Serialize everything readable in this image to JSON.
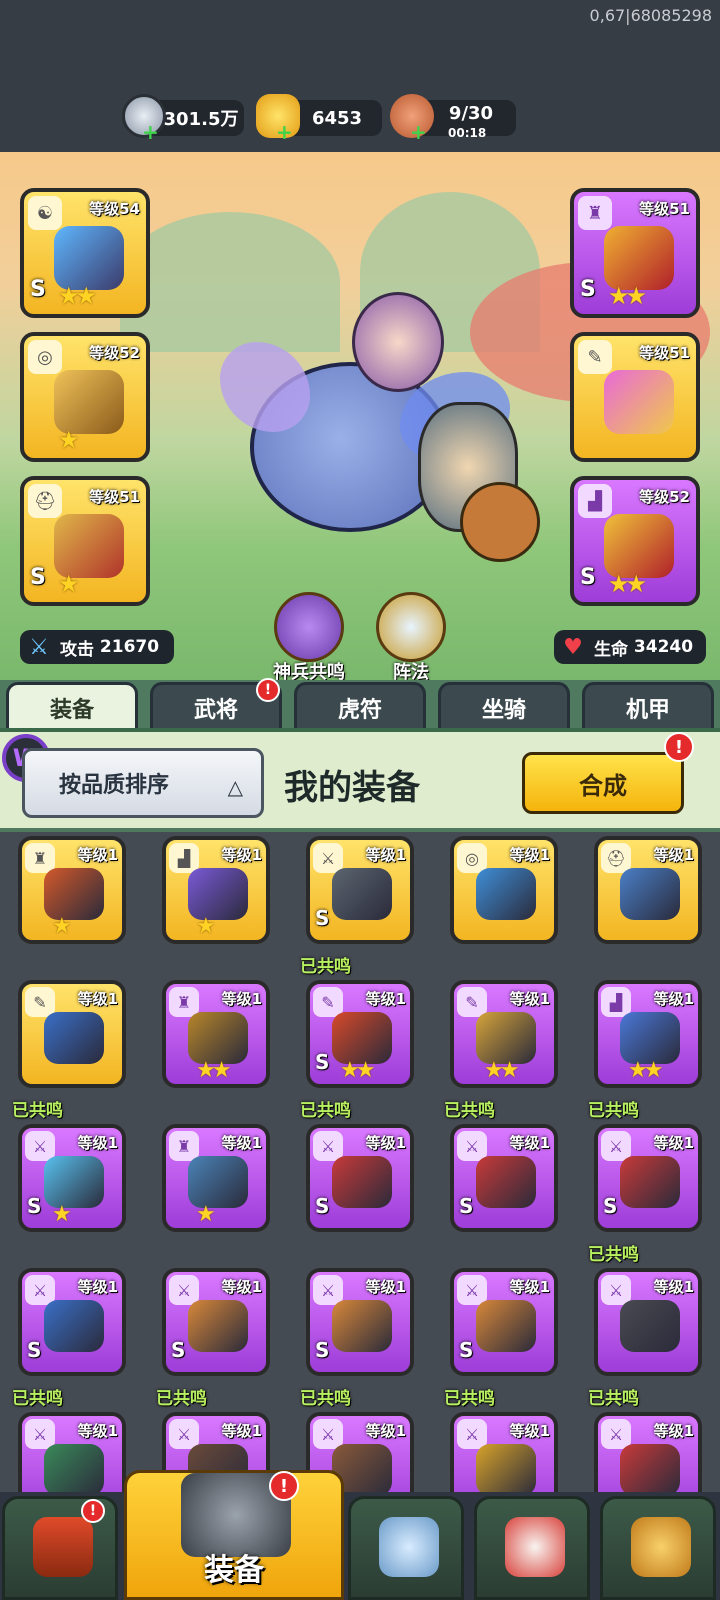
{
  "debug_text": "0,67|68085298",
  "resources": {
    "silver": {
      "value": "301.5万",
      "icon": "silver-coin-icon"
    },
    "gold": {
      "value": "6453",
      "icon": "gold-ingot-icon"
    },
    "stamina": {
      "value": "9/30",
      "timer": "00:18",
      "icon": "meat-leg-icon"
    }
  },
  "equipped_left": [
    {
      "slot": "weapon",
      "tag_icon": "yin-yang-icon",
      "level": "等级54",
      "rarity": "gold",
      "grade": "S",
      "stars": 2
    },
    {
      "slot": "necklace",
      "tag_icon": "medal-icon",
      "level": "等级52",
      "rarity": "gold",
      "grade": "",
      "stars": 1
    },
    {
      "slot": "helmet",
      "tag_icon": "helmet-icon",
      "level": "等级51",
      "rarity": "gold",
      "grade": "S",
      "stars": 1
    }
  ],
  "equipped_right": [
    {
      "slot": "armor",
      "tag_icon": "armor-icon",
      "level": "等级51",
      "rarity": "purple",
      "grade": "S",
      "stars": 2
    },
    {
      "slot": "bracer",
      "tag_icon": "bracer-icon",
      "level": "等级51",
      "rarity": "gold",
      "grade": "",
      "stars": 0
    },
    {
      "slot": "boots",
      "tag_icon": "boot-icon",
      "level": "等级52",
      "rarity": "purple",
      "grade": "S",
      "stars": 2
    }
  ],
  "stats": {
    "attack": {
      "label": "攻击",
      "value": "21670"
    },
    "hp": {
      "label": "生命",
      "value": "34240"
    }
  },
  "center_buttons": [
    "神兵共鸣",
    "阵法"
  ],
  "tabs": [
    "装备",
    "武将",
    "虎符",
    "坐骑",
    "机甲"
  ],
  "active_tab": 0,
  "header": {
    "sort_label": "按品质排序",
    "title": "我的装备",
    "merge_label": "合成"
  },
  "resonated_label": "已共鸣",
  "items": [
    {
      "rarity": "gold",
      "tag": "armor",
      "level": "等级1",
      "grade": "",
      "stars": 1,
      "resonated": false,
      "color": "#d4592b"
    },
    {
      "rarity": "gold",
      "tag": "boot",
      "level": "等级1",
      "grade": "",
      "stars": 1,
      "resonated": false,
      "color": "#7a5ad8"
    },
    {
      "rarity": "gold",
      "tag": "sword",
      "level": "等级1",
      "grade": "S",
      "stars": 0,
      "resonated": false,
      "color": "#5b6670"
    },
    {
      "rarity": "gold",
      "tag": "medal",
      "level": "等级1",
      "grade": "",
      "stars": 0,
      "resonated": false,
      "color": "#3f8fd8"
    },
    {
      "rarity": "gold",
      "tag": "helmet",
      "level": "等级1",
      "grade": "",
      "stars": 0,
      "resonated": false,
      "color": "#4a7fc8"
    },
    {
      "rarity": "gold",
      "tag": "bracer",
      "level": "等级1",
      "grade": "",
      "stars": 0,
      "resonated": false,
      "color": "#3a6fc8"
    },
    {
      "rarity": "purple",
      "tag": "armor",
      "level": "等级1",
      "grade": "",
      "stars": 2,
      "resonated": false,
      "color": "#b8862a"
    },
    {
      "rarity": "purple",
      "tag": "bracer",
      "level": "等级1",
      "grade": "S",
      "stars": 2,
      "resonated": true,
      "color": "#d84a2a"
    },
    {
      "rarity": "purple",
      "tag": "bracer",
      "level": "等级1",
      "grade": "",
      "stars": 2,
      "resonated": false,
      "color": "#d6a43a"
    },
    {
      "rarity": "purple",
      "tag": "boot",
      "level": "等级1",
      "grade": "",
      "stars": 2,
      "resonated": false,
      "color": "#4a78d8"
    },
    {
      "rarity": "purple",
      "tag": "sword",
      "level": "等级1",
      "grade": "S",
      "stars": 1,
      "resonated": true,
      "color": "#58c2f0"
    },
    {
      "rarity": "purple",
      "tag": "armor",
      "level": "等级1",
      "grade": "",
      "stars": 1,
      "resonated": false,
      "color": "#4a84b8"
    },
    {
      "rarity": "purple",
      "tag": "sword",
      "level": "等级1",
      "grade": "S",
      "stars": 0,
      "resonated": true,
      "color": "#c83a3a"
    },
    {
      "rarity": "purple",
      "tag": "sword",
      "level": "等级1",
      "grade": "S",
      "stars": 0,
      "resonated": true,
      "color": "#c83a3a"
    },
    {
      "rarity": "purple",
      "tag": "sword",
      "level": "等级1",
      "grade": "S",
      "stars": 0,
      "resonated": true,
      "color": "#c83a3a"
    },
    {
      "rarity": "purple",
      "tag": "sword",
      "level": "等级1",
      "grade": "S",
      "stars": 0,
      "resonated": false,
      "color": "#3a70c8"
    },
    {
      "rarity": "purple",
      "tag": "sword",
      "level": "等级1",
      "grade": "S",
      "stars": 0,
      "resonated": false,
      "color": "#d8883a"
    },
    {
      "rarity": "purple",
      "tag": "sword",
      "level": "等级1",
      "grade": "S",
      "stars": 0,
      "resonated": false,
      "color": "#d8883a"
    },
    {
      "rarity": "purple",
      "tag": "sword",
      "level": "等级1",
      "grade": "S",
      "stars": 0,
      "resonated": false,
      "color": "#d8883a"
    },
    {
      "rarity": "purple",
      "tag": "sword",
      "level": "等级1",
      "grade": "",
      "stars": 0,
      "resonated": true,
      "color": "#4a4a52"
    },
    {
      "rarity": "purple",
      "tag": "sword",
      "level": "等级1",
      "grade": "",
      "stars": 0,
      "resonated": true,
      "color": "#3a8a5a"
    },
    {
      "rarity": "purple",
      "tag": "sword",
      "level": "等级1",
      "grade": "",
      "stars": 0,
      "resonated": true,
      "color": "#6a4a3a"
    },
    {
      "rarity": "purple",
      "tag": "sword",
      "level": "等级1",
      "grade": "",
      "stars": 0,
      "resonated": true,
      "color": "#8a5a3a"
    },
    {
      "rarity": "purple",
      "tag": "sword",
      "level": "等级1",
      "grade": "",
      "stars": 0,
      "resonated": true,
      "color": "#d8a32a"
    },
    {
      "rarity": "purple",
      "tag": "sword",
      "level": "等级1",
      "grade": "",
      "stars": 0,
      "resonated": true,
      "color": "#c83a3a"
    }
  ],
  "bottom_nav": [
    {
      "name": "shop-gate",
      "label": "",
      "icon": "temple-gate-icon",
      "badge": true
    },
    {
      "name": "equipment",
      "label": "装备",
      "icon": "helmet-icon",
      "badge": true,
      "active": true
    },
    {
      "name": "arena",
      "label": "",
      "icon": "crossed-swords-shield-icon",
      "badge": false
    },
    {
      "name": "hero",
      "label": "",
      "icon": "rooster-hero-icon",
      "badge": false
    },
    {
      "name": "upgrade",
      "label": "",
      "icon": "fist-upgrade-icon",
      "badge": false
    }
  ],
  "colors": {
    "gold_card": "#f3b522",
    "purple_card": "#9e3dd8",
    "resonated_text": "#b8f060",
    "badge_red": "#e42a2a"
  }
}
